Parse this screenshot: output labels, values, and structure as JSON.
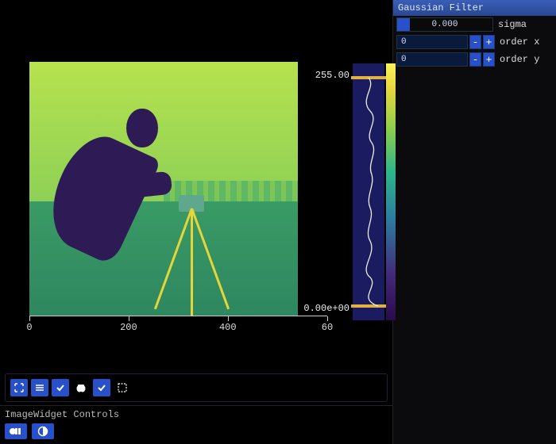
{
  "panel": {
    "title": "Gaussian Filter",
    "sigma": {
      "value": "0.000",
      "label": "sigma"
    },
    "order_x": {
      "value": "0",
      "label": "order x",
      "minus": "-",
      "plus": "+"
    },
    "order_y": {
      "value": "0",
      "label": "order y",
      "minus": "-",
      "plus": "+"
    }
  },
  "viewer": {
    "xaxis": {
      "t0": "0",
      "t1": "200",
      "t2": "400",
      "t3": "60"
    },
    "hist": {
      "max_label": "255.00",
      "min_label": "0.00e+00"
    }
  },
  "footer": {
    "title": "ImageWidget Controls"
  }
}
